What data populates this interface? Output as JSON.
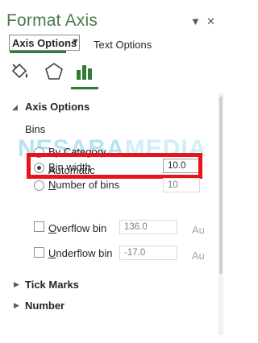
{
  "pane": {
    "title": "Format Axis",
    "dropdown_glyph": "▼",
    "close_glyph": "✕"
  },
  "tabs": {
    "axis_options": "Axis Options",
    "caret": "▼",
    "text_options": "Text Options"
  },
  "icons": [
    "fill-line-icon",
    "effects-pentagon-icon",
    "axis-options-bars-icon"
  ],
  "axis_options": {
    "header": "Axis Options",
    "expanded": true,
    "bins_label": "Bins",
    "options": [
      {
        "label": "By Category",
        "accel": "",
        "selected": false
      },
      {
        "label": "Automatic",
        "accel": "",
        "selected": false
      },
      {
        "label": "in width",
        "accel": "B",
        "selected": true,
        "value": "10.0"
      },
      {
        "label": "umber of bins",
        "accel": "N",
        "selected": false,
        "value": "10"
      }
    ],
    "overflow": {
      "accel": "O",
      "label": "verflow bin",
      "value": "136.0",
      "suffix": "Au",
      "checked": false
    },
    "underflow": {
      "accel": "U",
      "label": "nderflow bin",
      "value": "-17.0",
      "suffix": "Au",
      "checked": false
    }
  },
  "sections": {
    "tick_marks": "Tick Marks",
    "number": "Number",
    "collapsed_glyph": "▶",
    "expanded_glyph": "◢"
  },
  "watermark": {
    "left": "NESABA",
    "right": "MEDIA"
  },
  "colors": {
    "title_green": "#4a7a4a",
    "accent_green": "#2e7d32",
    "highlight_red": "#e8141c",
    "watermark_cyan": "#7fd0e8"
  }
}
